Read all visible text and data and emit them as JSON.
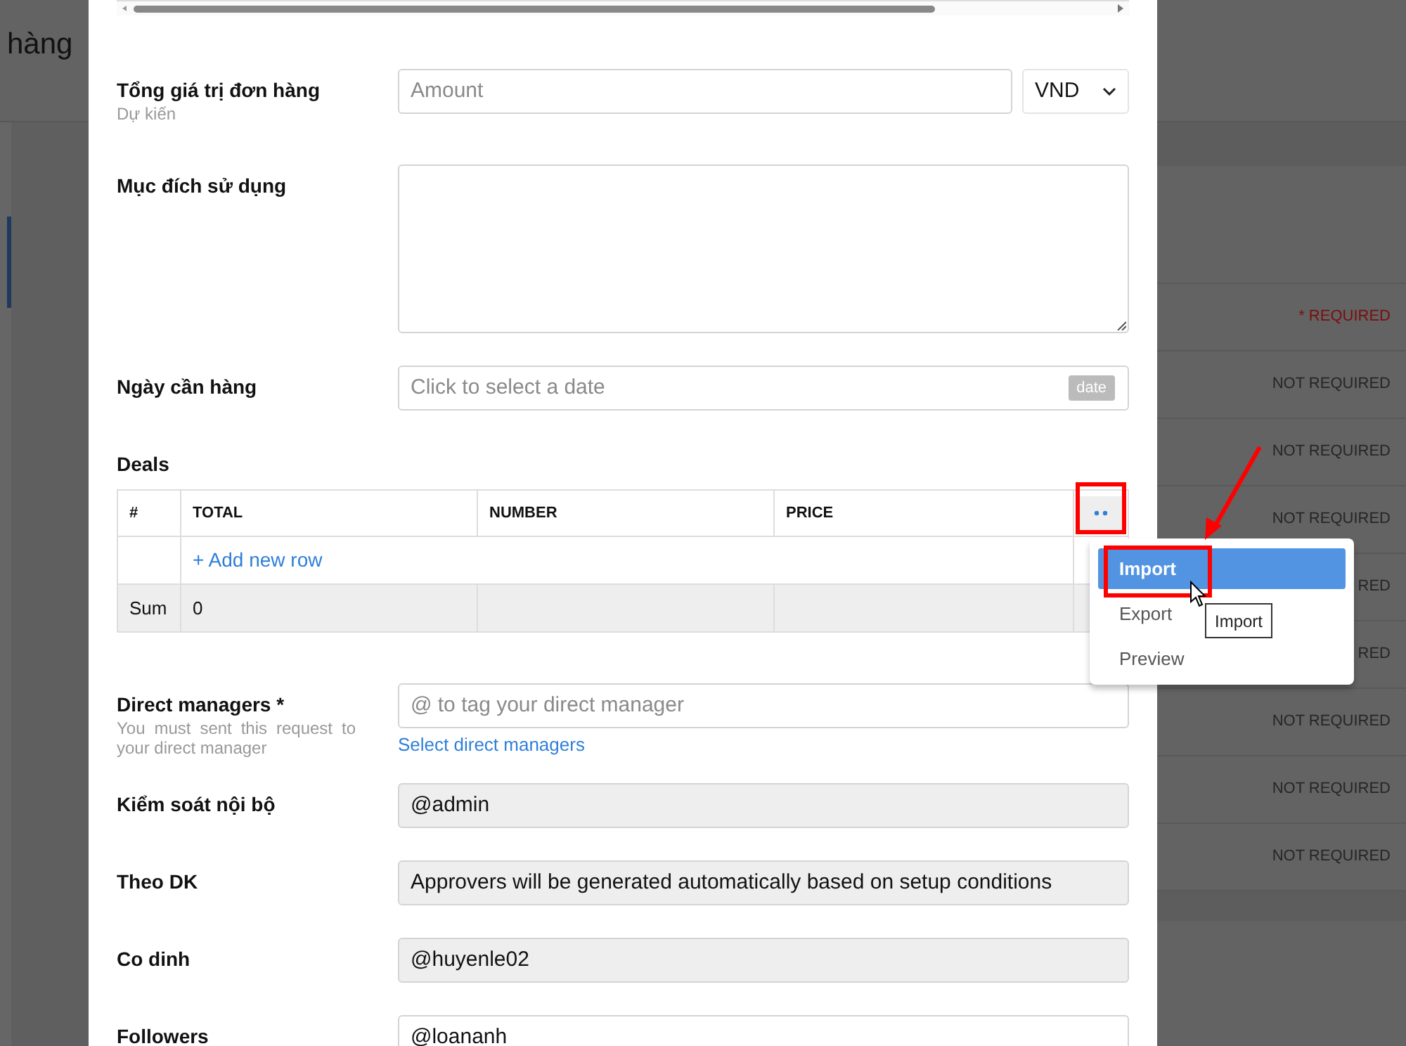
{
  "background": {
    "title": "hàng",
    "rows": [
      {
        "text": "* REQUIRED",
        "kind": "required"
      },
      {
        "text": "NOT REQUIRED",
        "kind": "optional"
      },
      {
        "text": "NOT REQUIRED",
        "kind": "optional"
      },
      {
        "text": "NOT REQUIRED",
        "kind": "optional"
      },
      {
        "text": "RED",
        "kind": "optional"
      },
      {
        "text": "RED",
        "kind": "optional"
      },
      {
        "text": "NOT REQUIRED",
        "kind": "optional"
      },
      {
        "text": "NOT REQUIRED",
        "kind": "optional"
      },
      {
        "text": "NOT REQUIRED",
        "kind": "optional"
      }
    ]
  },
  "form": {
    "fields_top": [
      {
        "kind": "amount",
        "label": "Tổng giá trị đơn hàng",
        "sublabel": "Dự kiến",
        "placeholder": "Amount",
        "currency": "VND"
      },
      {
        "kind": "textarea",
        "label": "Mục đích sử dụng"
      },
      {
        "kind": "date",
        "label": "Ngày cần hàng",
        "placeholder": "Click to select a date",
        "badge": "date"
      }
    ],
    "deals": {
      "title": "Deals",
      "columns": [
        "#",
        "TOTAL",
        "NUMBER",
        "PRICE"
      ],
      "add_row": "+ Add new row",
      "sum_row": [
        "Sum",
        "0"
      ]
    },
    "fields_bottom": [
      {
        "kind": "tag_input",
        "label": "Direct managers *",
        "sublabel": "You must sent this request to your direct manager",
        "placeholder": "@ to tag your direct manager",
        "link": "Select direct managers"
      },
      {
        "kind": "readonly",
        "label": "Kiểm soát nội bộ",
        "value": "@admin"
      },
      {
        "kind": "readonly",
        "label": "Theo DK",
        "value": "Approvers will be generated automatically based on setup conditions"
      },
      {
        "kind": "readonly",
        "label": "Co dinh",
        "value": "@huyenle02"
      },
      {
        "kind": "input",
        "label": "Followers",
        "value": "@loananh"
      }
    ]
  },
  "menu": {
    "items": [
      {
        "label": "Import",
        "selected": true
      },
      {
        "label": "Export",
        "selected": false
      },
      {
        "label": "Preview",
        "selected": false
      }
    ],
    "tooltip": "Import"
  }
}
